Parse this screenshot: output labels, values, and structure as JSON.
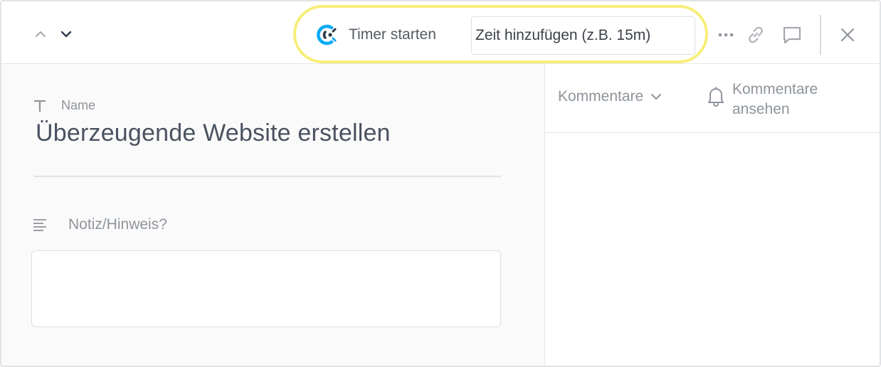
{
  "toolbar": {
    "timer_label": "Timer starten",
    "time_placeholder": "Zeit hinzufügen (z.B. 15m)",
    "icons": [
      "chevron-up-icon",
      "chevron-down-icon",
      "clockify-icon",
      "more-icon",
      "link-icon",
      "comment-icon",
      "close-icon"
    ]
  },
  "task": {
    "name_label": "Name",
    "title": "Überzeugende Website erstellen",
    "note_label": "Notiz/Hinweis?",
    "note_value": ""
  },
  "comments": {
    "dropdown_label": "Kommentare",
    "watch_label": "Kommentare ansehen"
  },
  "colors": {
    "highlight": "#f7ee7a",
    "accent_blue": "#03a9f4",
    "text_muted": "#8e949b",
    "text_title": "#4a5260"
  }
}
